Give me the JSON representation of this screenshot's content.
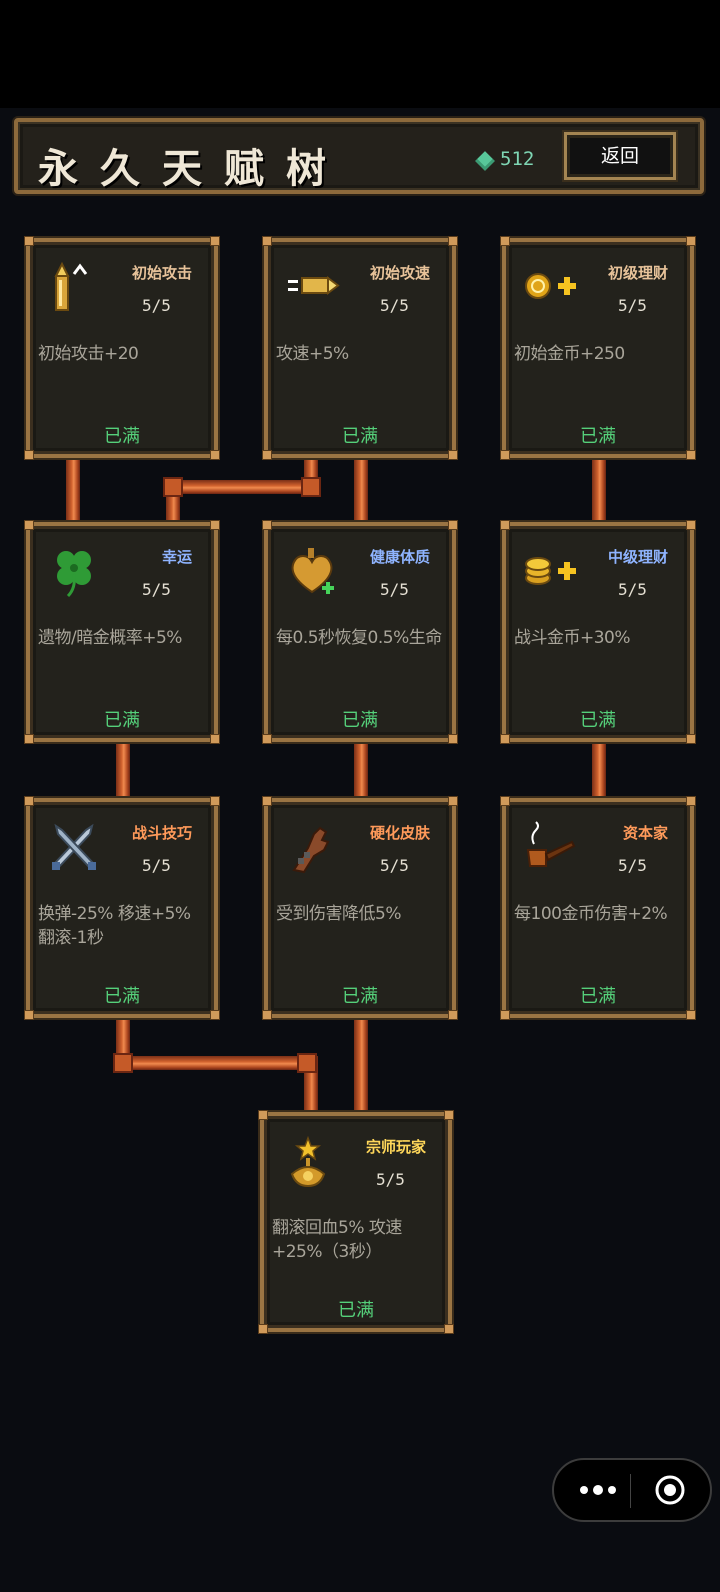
{
  "header": {
    "title": "永久天赋树",
    "currency_amount": "512",
    "back_label": "返回"
  },
  "talents": [
    {
      "name": "初始攻击",
      "level": "5/5",
      "desc": "初始攻击+20",
      "status": "已满",
      "name_color": "#e8c39a",
      "icon": "bullet-upgrade-icon"
    },
    {
      "name": "初始攻速",
      "level": "5/5",
      "desc": "攻速+5%",
      "status": "已满",
      "name_color": "#e8c39a",
      "icon": "speed-bullet-icon"
    },
    {
      "name": "初级理财",
      "level": "5/5",
      "desc": "初始金币+250",
      "status": "已满",
      "name_color": "#e8c39a",
      "icon": "coin-plus-icon"
    },
    {
      "name": "幸运",
      "level": "5/5",
      "desc": "遗物/暗金概率+5%",
      "status": "已满",
      "name_color": "#8fb4ff",
      "icon": "four-leaf-clover-icon"
    },
    {
      "name": "健康体质",
      "level": "5/5",
      "desc": "每0.5秒恢复0.5%生命",
      "status": "已满",
      "name_color": "#8fb4ff",
      "icon": "heart-plus-icon"
    },
    {
      "name": "中级理财",
      "level": "5/5",
      "desc": "战斗金币+30%",
      "status": "已满",
      "name_color": "#8fb4ff",
      "icon": "coin-stack-plus-icon"
    },
    {
      "name": "战斗技巧",
      "level": "5/5",
      "desc": "换弹-25% 移速+5% 翻滚-1秒",
      "status": "已满",
      "name_color": "#ff9a5a",
      "icon": "crossed-knives-icon"
    },
    {
      "name": "硬化皮肤",
      "level": "5/5",
      "desc": "受到伤害降低5%",
      "status": "已满",
      "name_color": "#ff9a5a",
      "icon": "armored-arm-icon"
    },
    {
      "name": "资本家",
      "level": "5/5",
      "desc": "每100金币伤害+2%",
      "status": "已满",
      "name_color": "#ff9a5a",
      "icon": "pipe-icon"
    },
    {
      "name": "宗师玩家",
      "level": "5/5",
      "desc": "翻滚回血5% 攻速+25%（3秒）",
      "status": "已满",
      "name_color": "#ffd75a",
      "icon": "grandmaster-medal-icon"
    }
  ],
  "colors": {
    "status_maxed": "#55d07a",
    "currency": "#7fd6b4",
    "pipe": "#d0612d",
    "card_border": "#9a7443"
  }
}
